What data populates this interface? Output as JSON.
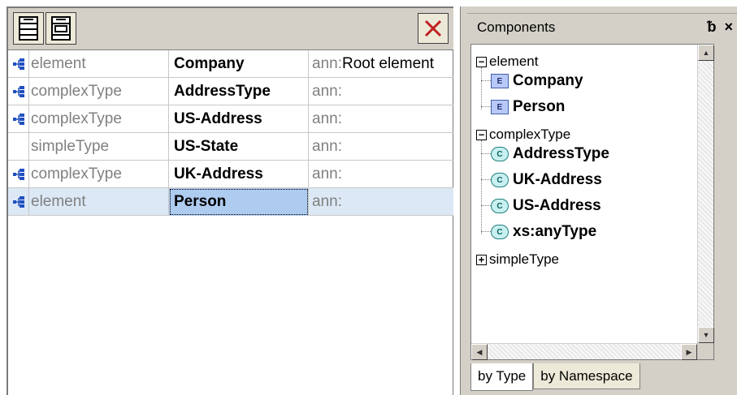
{
  "schema_table": {
    "rows": [
      {
        "icon": "element-expand-icon",
        "kind": "element",
        "name": "Company",
        "ann_key": "ann:",
        "ann_val": "Root element",
        "selected": false
      },
      {
        "icon": "element-expand-icon",
        "kind": "complexType",
        "name": "AddressType",
        "ann_key": "ann:",
        "ann_val": "",
        "selected": false
      },
      {
        "icon": "element-expand-icon",
        "kind": "complexType",
        "name": "US-Address",
        "ann_key": "ann:",
        "ann_val": "",
        "selected": false
      },
      {
        "icon": "",
        "kind": "simpleType",
        "name": "US-State",
        "ann_key": "ann:",
        "ann_val": "",
        "selected": false
      },
      {
        "icon": "element-expand-icon",
        "kind": "complexType",
        "name": "UK-Address",
        "ann_key": "ann:",
        "ann_val": "",
        "selected": false
      },
      {
        "icon": "element-expand-icon",
        "kind": "element",
        "name": "Person",
        "ann_key": "ann:",
        "ann_val": "",
        "selected": true
      }
    ]
  },
  "components": {
    "title": "Components",
    "pin_glyph": "p",
    "close_glyph": "×",
    "tree": {
      "element": {
        "label": "element",
        "toggle": "−",
        "items": [
          "Company",
          "Person"
        ],
        "icon_letter": "E"
      },
      "complexType": {
        "label": "complexType",
        "toggle": "−",
        "items": [
          "AddressType",
          "UK-Address",
          "US-Address",
          "xs:anyType"
        ],
        "icon_letter": "C"
      },
      "simpleType": {
        "label": "simpleType",
        "toggle": "+"
      }
    },
    "tabs": [
      "by Type",
      "by Namespace"
    ],
    "active_tab": 0
  }
}
